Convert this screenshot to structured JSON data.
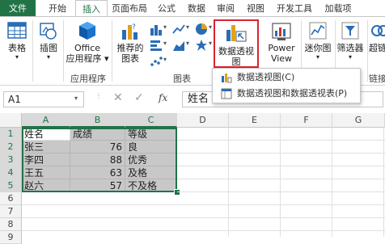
{
  "tabs": [
    "文件",
    "开始",
    "插入",
    "页面布局",
    "公式",
    "数据",
    "审阅",
    "视图",
    "开发工具",
    "加载项"
  ],
  "active_tab": "插入",
  "ribbon": {
    "table_label": "表格",
    "illustrations_label": "插图",
    "office_line1": "Office",
    "office_line2": "应用程序 ▾",
    "recommended_line1": "推荐的",
    "recommended_line2": "图表",
    "pivotchart_line1": "数据透视图",
    "pivotchart_arrow": "▾",
    "powerview_line1": "Power",
    "powerview_line2": "View",
    "sparklines_label": "迷你图",
    "filter_label": "筛选器",
    "hyperlink_label": "超链",
    "group_apps": "应用程序",
    "group_charts": "图表",
    "group_link": "链接"
  },
  "dropdown": {
    "item1": "数据透视图(C)",
    "item2": "数据透视图和数据透视表(P)"
  },
  "formula_bar": {
    "name_box": "A1",
    "fx_label": "fx",
    "content": "姓名"
  },
  "columns": [
    "A",
    "B",
    "C",
    "D",
    "E",
    "F",
    "G"
  ],
  "rows": [
    "1",
    "2",
    "3",
    "4",
    "5",
    "6",
    "7",
    "8",
    "9"
  ],
  "sheet": {
    "headers": [
      "姓名",
      "成绩",
      "等级"
    ],
    "data": [
      [
        "张三",
        "76",
        "良"
      ],
      [
        "李四",
        "88",
        "优秀"
      ],
      [
        "王五",
        "63",
        "及格"
      ],
      [
        "赵六",
        "57",
        "不及格"
      ]
    ]
  },
  "colors": {
    "accent": "#217346",
    "highlight": "#d9232d",
    "selection": "#c8c8c8"
  }
}
